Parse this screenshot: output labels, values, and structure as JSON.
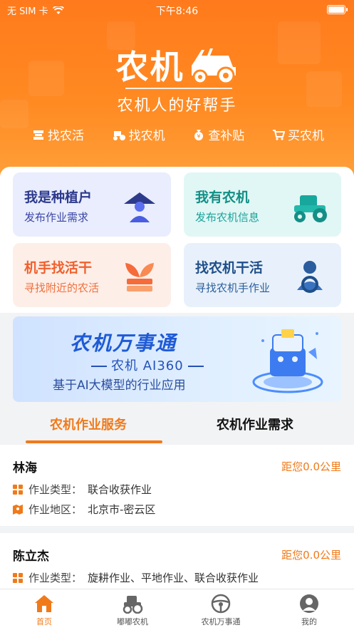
{
  "status_bar": {
    "carrier": "无 SIM 卡",
    "time": "下午8:46"
  },
  "header": {
    "logo_text": "农机",
    "slogan": "农机人的好帮手",
    "quick_nav": [
      {
        "label": "找农活",
        "icon": "work-icon"
      },
      {
        "label": "找农机",
        "icon": "tractor-icon"
      },
      {
        "label": "查补贴",
        "icon": "money-bag-icon"
      },
      {
        "label": "买农机",
        "icon": "cart-icon"
      }
    ]
  },
  "cards": [
    {
      "title": "我是种植户",
      "subtitle": "发布作业需求",
      "icon": "farmer-icon"
    },
    {
      "title": "我有农机",
      "subtitle": "发布农机信息",
      "icon": "tractor-icon"
    },
    {
      "title": "机手找活干",
      "subtitle": "寻找附近的农活",
      "icon": "sprout-icon"
    },
    {
      "title": "找农机干活",
      "subtitle": "寻找农机手作业",
      "icon": "driver-icon"
    }
  ],
  "banner": {
    "title": "农机万事通",
    "subtitle": "农机 AI360",
    "description": "基于AI大模型的行业应用"
  },
  "tabs": {
    "active": "农机作业服务",
    "inactive": "农机作业需求"
  },
  "list": [
    {
      "name": "林海",
      "distance": "距您0.0公里",
      "type_label": "作业类型：",
      "type_value": "联合收获作业",
      "area_label": "作业地区：",
      "area_value": "北京市-密云区"
    },
    {
      "name": "陈立杰",
      "distance": "距您0.0公里",
      "type_label": "作业类型：",
      "type_value": "旋耕作业、平地作业、联合收获作业"
    }
  ],
  "tab_bar": [
    {
      "label": "首页",
      "icon": "home-icon",
      "active": true
    },
    {
      "label": "嘟嘟农机",
      "icon": "tractor-icon",
      "active": false
    },
    {
      "label": "农机万事通",
      "icon": "steering-wheel-icon",
      "active": false
    },
    {
      "label": "我的",
      "icon": "user-icon",
      "active": false
    }
  ],
  "colors": {
    "accent": "#f07a1a",
    "header_orange": "#ff8a22"
  }
}
